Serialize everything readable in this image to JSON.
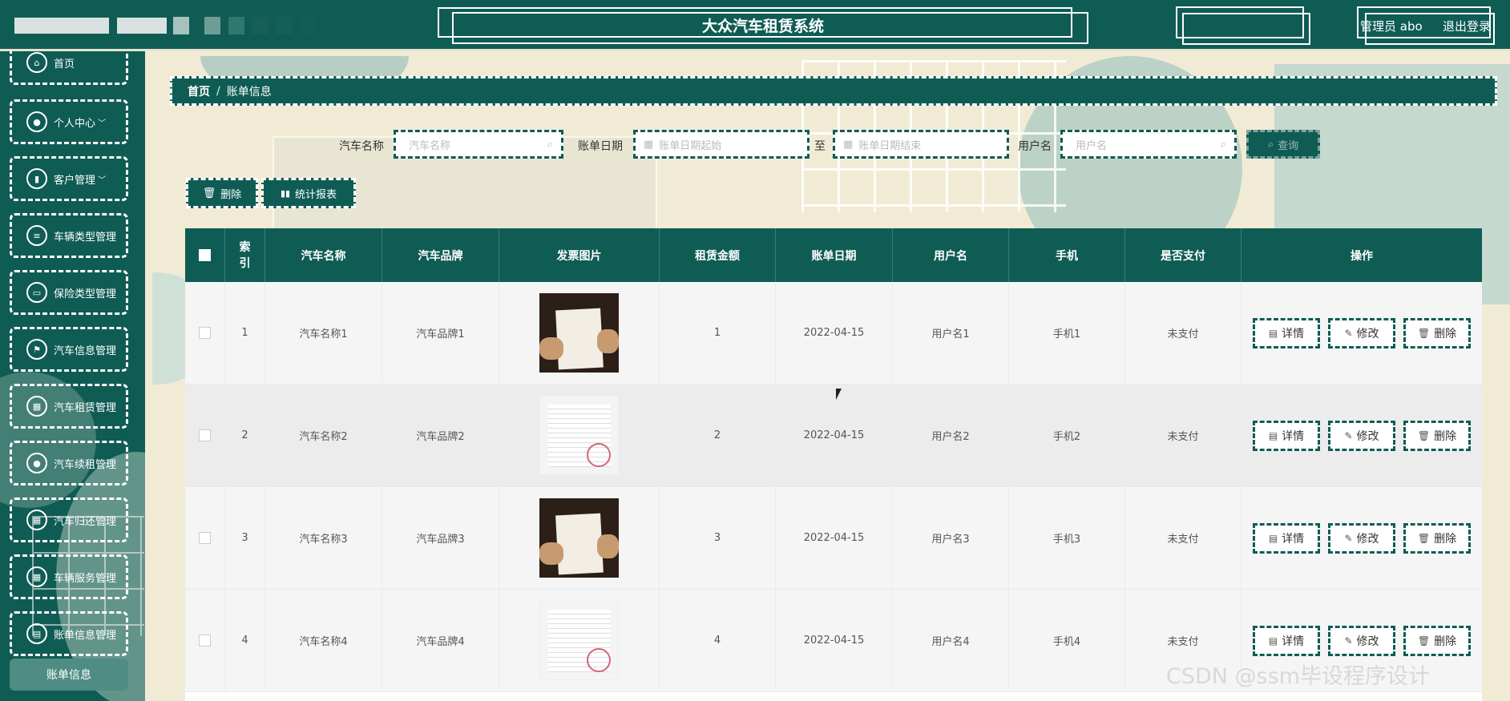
{
  "header": {
    "title": "大众汽车租赁系统",
    "admin_label": "管理员 abo",
    "logout_label": "退出登录"
  },
  "sidebar": {
    "items": [
      {
        "label": "首页",
        "icon": "home-icon",
        "caret": ""
      },
      {
        "label": "个人中心",
        "icon": "user-icon",
        "caret": "﹀"
      },
      {
        "label": "客户管理",
        "icon": "book-icon",
        "caret": "﹀"
      },
      {
        "label": "车辆类型管理",
        "icon": "sliders-icon",
        "caret": ""
      },
      {
        "label": "保险类型管理",
        "icon": "monitor-icon",
        "caret": ""
      },
      {
        "label": "汽车信息管理",
        "icon": "flag-icon",
        "caret": ""
      },
      {
        "label": "汽车租赁管理",
        "icon": "grid-icon",
        "caret": ""
      },
      {
        "label": "汽车续租管理",
        "icon": "location-icon",
        "caret": ""
      },
      {
        "label": "汽车归还管理",
        "icon": "grid-icon",
        "caret": ""
      },
      {
        "label": "车辆服务管理",
        "icon": "grid-icon",
        "caret": ""
      },
      {
        "label": "账单信息管理",
        "icon": "briefcase-icon",
        "caret": ""
      }
    ],
    "active_label": "账单信息"
  },
  "breadcrumb": {
    "home": "首页",
    "separator": "/",
    "current": "账单信息"
  },
  "search": {
    "car_name_label": "汽车名称",
    "car_name_placeholder": "汽车名称",
    "bill_date_label": "账单日期",
    "date_start_placeholder": "账单日期起始",
    "date_to": "至",
    "date_end_placeholder": "账单日期结束",
    "username_label": "用户名",
    "username_placeholder": "用户名",
    "query_label": "查询"
  },
  "toolbar": {
    "delete_label": "删除",
    "report_label": "统计报表"
  },
  "table": {
    "headers": [
      "索引",
      "汽车名称",
      "汽车品牌",
      "发票图片",
      "租赁金额",
      "账单日期",
      "用户名",
      "手机",
      "是否支付",
      "操作"
    ],
    "rows": [
      {
        "index": "1",
        "car_name": "汽车名称1",
        "brand": "汽车品牌1",
        "image": "dark",
        "amount": "1",
        "date": "2022-04-15",
        "username": "用户名1",
        "phone": "手机1",
        "paid": "未支付"
      },
      {
        "index": "2",
        "car_name": "汽车名称2",
        "brand": "汽车品牌2",
        "image": "light",
        "amount": "2",
        "date": "2022-04-15",
        "username": "用户名2",
        "phone": "手机2",
        "paid": "未支付"
      },
      {
        "index": "3",
        "car_name": "汽车名称3",
        "brand": "汽车品牌3",
        "image": "dark",
        "amount": "3",
        "date": "2022-04-15",
        "username": "用户名3",
        "phone": "手机3",
        "paid": "未支付"
      },
      {
        "index": "4",
        "car_name": "汽车名称4",
        "brand": "汽车品牌4",
        "image": "light",
        "amount": "4",
        "date": "2022-04-15",
        "username": "用户名4",
        "phone": "手机4",
        "paid": "未支付"
      }
    ],
    "actions": {
      "detail": "详情",
      "edit": "修改",
      "delete": "删除"
    }
  },
  "watermark": "CSDN @ssm毕设程序设计",
  "colors": {
    "primary": "#0f5c55",
    "background": "#f1ebd6"
  }
}
